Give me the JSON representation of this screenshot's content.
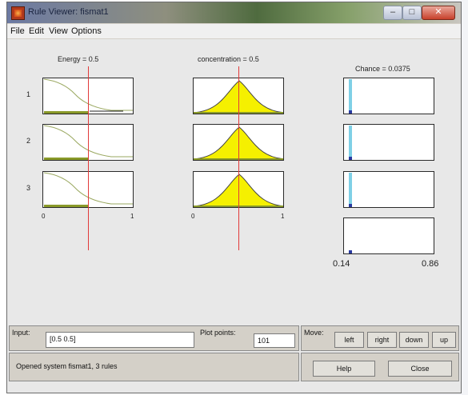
{
  "window": {
    "title": "Rule Viewer: fismat1"
  },
  "menu": [
    "File",
    "Edit",
    "View",
    "Options"
  ],
  "variables": {
    "input1_label": "Energy = 0.5",
    "input2_label": "concentration = 0.5",
    "output_label": "Chance = 0.0375"
  },
  "rules": [
    "1",
    "2",
    "3"
  ],
  "axes": {
    "input1_min": "0",
    "input1_max": "1",
    "input2_min": "0",
    "input2_max": "1",
    "output_min": "0.14",
    "output_max": "0.86"
  },
  "controls": {
    "input_label": "Input:",
    "input_value": "[0.5 0.5]",
    "plot_points_label": "Plot points:",
    "plot_points_value": "101",
    "move_label": "Move:",
    "left": "left",
    "right": "right",
    "down": "down",
    "up": "up",
    "status": "Opened system fismat1, 3 rules",
    "help": "Help",
    "close": "Close"
  },
  "colors": {
    "fill": "#f5f000",
    "line": "#e23a3a",
    "output_bar": "#7fd0e6"
  }
}
